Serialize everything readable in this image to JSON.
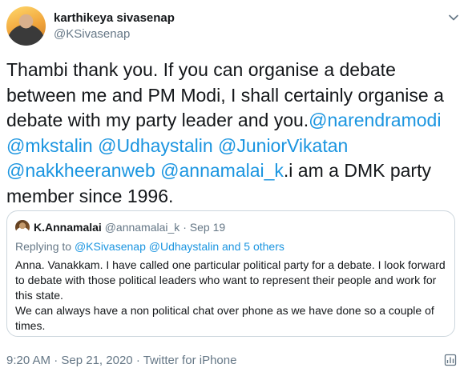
{
  "author": {
    "display_name": "karthikeya sivasenap",
    "handle": "@KSivasenap"
  },
  "tweet": {
    "text_before": "Thambi thank you. If you can organise a debate between me and PM Modi, I shall certainly organise a debate with my party leader and you.",
    "mentions": [
      "@narendramodi",
      "@mkstalin",
      "@Udhaystalin",
      "@JuniorVikatan",
      "@nakkheeranweb",
      "@annamalai_k"
    ],
    "text_after": ".i am a DMK party member since 1996."
  },
  "quoted": {
    "display_name": "K.Annamalai",
    "handle": "@annamalai_k",
    "separator": "·",
    "date": "Sep 19",
    "reply_prefix": "Replying to",
    "reply_mentions": "@KSivasenap @Udhaystalin",
    "reply_suffix": "and 5 others",
    "text": "Anna. Vanakkam. I have called one particular political party for a debate. I look forward to debate with those political leaders who want to represent their people and work for this state.\nWe can always have a non political chat over phone as we have done so a couple of times."
  },
  "footer": {
    "time": "9:20 AM",
    "date": "Sep 21, 2020",
    "separator": "·",
    "source": "Twitter for iPhone"
  },
  "colors": {
    "link": "#1b95e0",
    "muted": "#657786",
    "text": "#14171a",
    "border": "#ccd6dd"
  },
  "icons": {
    "menu": "chevron-down-icon",
    "analytics": "analytics-icon"
  }
}
